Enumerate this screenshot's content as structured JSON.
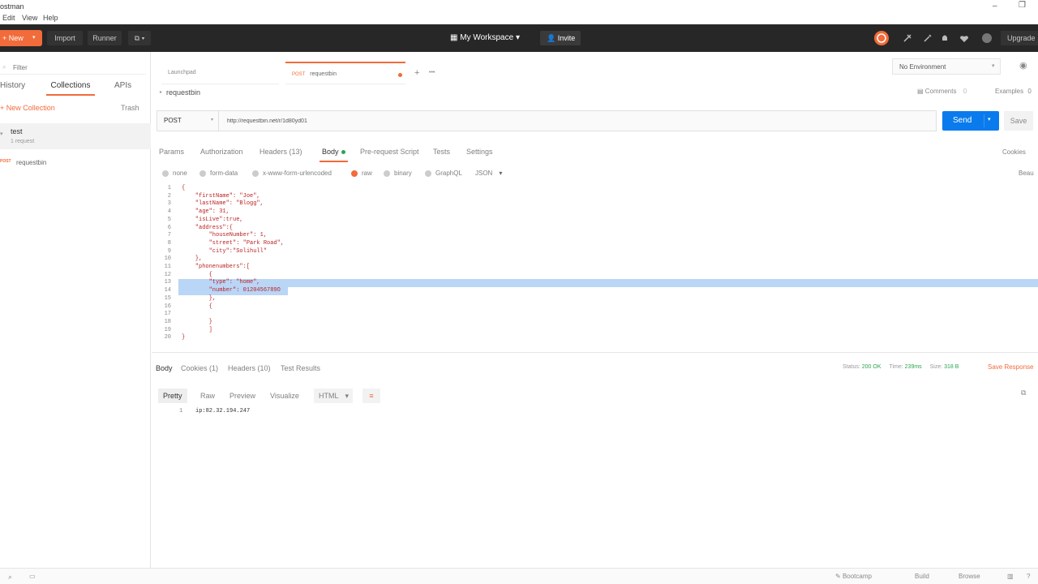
{
  "titlebar": {
    "app": "ostman"
  },
  "menu": [
    "Edit",
    "View",
    "Help"
  ],
  "header": {
    "new_label": "New",
    "import_label": "Import",
    "runner_label": "Runner",
    "workspace_label": "My Workspace",
    "invite_label": "Invite",
    "upgrade_label": "Upgrade"
  },
  "sidebar": {
    "filter_placeholder": "Filter",
    "tabs": [
      "History",
      "Collections",
      "APIs"
    ],
    "new_collection": "+ New Collection",
    "trash": "Trash",
    "collection": {
      "name": "test",
      "count": "1 request"
    },
    "request": {
      "method": "POST",
      "name": "requestbin"
    }
  },
  "tabs": {
    "launchpad": "Launchpad",
    "active_method": "POST",
    "active_name": "requestbin",
    "add": "+",
    "more": "•••"
  },
  "environment": {
    "selected": "No Environment"
  },
  "breadcrumb": "requestbin",
  "comments": {
    "label": "Comments",
    "count": "0"
  },
  "examples": {
    "label": "Examples",
    "count": "0"
  },
  "request": {
    "method": "POST",
    "url": "http://requestbin.net/r/1d80yd01",
    "send": "Send",
    "save": "Save"
  },
  "request_tabs": [
    "Params",
    "Authorization",
    "Headers (13)",
    "Body",
    "Pre-request Script",
    "Tests",
    "Settings"
  ],
  "cookies_link": "Cookies",
  "beautify_link": "Beau",
  "body_types": [
    "none",
    "form-data",
    "x-www-form-urlencoded",
    "raw",
    "binary",
    "GraphQL"
  ],
  "body_format": "JSON",
  "code_lines": [
    "{",
    "    \"firstName\": \"Joe\",",
    "    \"lastName\": \"Blogg\",",
    "    \"age\": 31,",
    "    \"isLive\":true,",
    "    \"address\":{",
    "        \"houseNumber\": 1,",
    "        \"street\": \"Park Road\",",
    "        \"city\":\"Solihull\"",
    "    },",
    "    \"phonenumbers\":[",
    "        {",
    "        \"type\": \"home\",",
    "        \"number\": 0120456789O",
    "        },",
    "        {",
    "",
    "        }",
    "        ]",
    "}"
  ],
  "response": {
    "tabs": [
      "Body",
      "Cookies (1)",
      "Headers (10)",
      "Test Results"
    ],
    "status_label": "Status:",
    "status": "200 OK",
    "time_label": "Time:",
    "time": "239ms",
    "size_label": "Size:",
    "size": "318 B",
    "save_response": "Save Response",
    "views": [
      "Pretty",
      "Raw",
      "Preview",
      "Visualize"
    ],
    "format": "HTML",
    "line_no": "1",
    "body": "ip:82.32.194.247"
  },
  "footer": {
    "bootcamp": "Bootcamp",
    "build": "Build",
    "browse": "Browse"
  },
  "colors": {
    "accent": "#f26b3a",
    "send": "#097bed",
    "header_bg": "#272727",
    "selection": "#b9d6f7"
  }
}
